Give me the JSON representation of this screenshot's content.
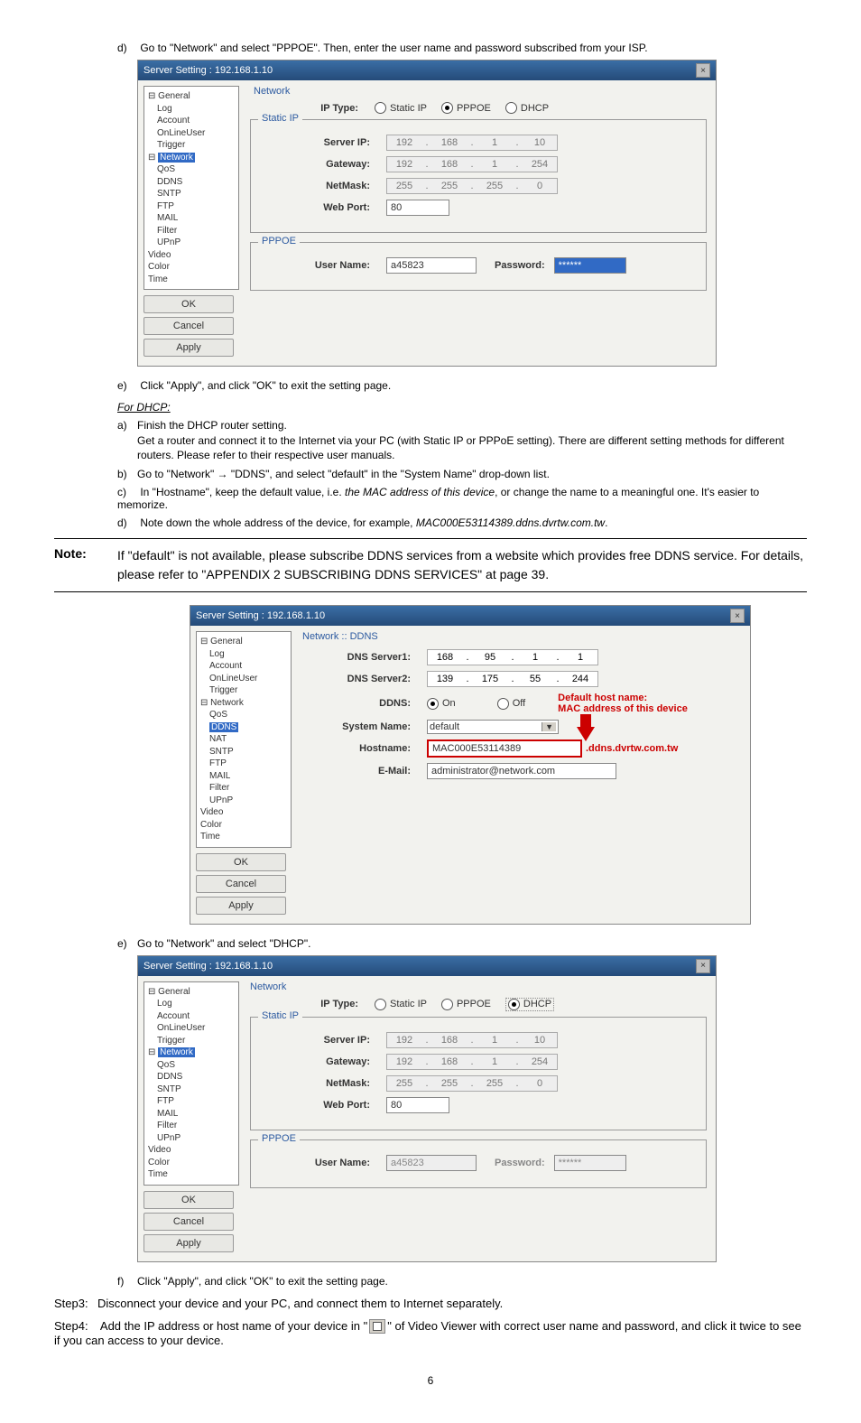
{
  "steps_pppoe": {
    "d": "Go to \"Network\" and select \"PPPOE\". Then, enter the user name and password subscribed from your ISP.",
    "e": "Click \"Apply\", and click \"OK\" to exit the setting page."
  },
  "dhcp_heading": "For DHCP:",
  "dhcp_steps": {
    "a1": "Finish the DHCP router setting.",
    "a2": "Get a router and connect it to the Internet via your PC (with Static IP or PPPoE setting). There are different setting methods for different routers. Please refer to their respective user manuals.",
    "b": "Go to \"Network\" → \"DDNS\", and select \"default\" in the \"System Name\" drop-down list.",
    "c1": "In \"Hostname\", keep the default value, i.e. ",
    "c1_italic": "the MAC address of this device",
    "c1_tail": ", or change the name to a meaningful one. It's easier to memorize.",
    "d1": "Note down the whole address of the device, for example, ",
    "d1_italic": "MAC000E53114389.ddns.dvrtw.com.tw",
    "d1_tail": "."
  },
  "note": {
    "label": "Note:",
    "text": "If \"default\" is not available, please subscribe DDNS services from a website which provides free DDNS service. For details, please refer to \"APPENDIX 2 SUBSCRIBING DDNS SERVICES\" at page 39."
  },
  "dhcp_e": "Go to \"Network\" and select \"DHCP\".",
  "dhcp_f": "Click \"Apply\", and click \"OK\" to exit the setting page.",
  "step3": "Disconnect your device and your PC, and connect them to Internet separately.",
  "step4a": "Add the IP address or host name of your device in \"",
  "step4b": "\" of Video Viewer with correct user name and password, and click it twice to see if you can access to your device.",
  "page_number": "6",
  "window": {
    "title": "Server Setting : 192.168.1.10",
    "buttons": {
      "ok": "OK",
      "cancel": "Cancel",
      "apply": "Apply"
    },
    "tree": {
      "general": "General",
      "log": "Log",
      "account": "Account",
      "online": "OnLineUser",
      "trigger": "Trigger",
      "network": "Network",
      "qos": "QoS",
      "ddns": "DDNS",
      "nat": "NAT",
      "sntp": "SNTP",
      "ftp": "FTP",
      "mail": "MAIL",
      "filter": "Filter",
      "upnp": "UPnP",
      "video": "Video",
      "color": "Color",
      "time": "Time"
    },
    "network_label": "Network",
    "ddns_label": "Network :: DDNS",
    "labels": {
      "iptype": "IP Type:",
      "staticip_group": "Static IP",
      "serverip": "Server IP:",
      "gateway": "Gateway:",
      "netmask": "NetMask:",
      "webport": "Web Port:",
      "pppoe_group": "PPPOE",
      "username": "User Name:",
      "password": "Password:",
      "dns1": "DNS Server1:",
      "dns2": "DNS Server2:",
      "ddns": "DDNS:",
      "sysname": "System Name:",
      "hostname": "Hostname:",
      "email": "E-Mail:",
      "defhost": "Default host name:",
      "macaddr": "MAC address of this device"
    },
    "radios": {
      "static": "Static IP",
      "pppoe": "PPPOE",
      "dhcp": "DHCP",
      "on": "On",
      "off": "Off"
    },
    "values": {
      "ip": [
        "192",
        "168",
        "1",
        "10"
      ],
      "gw": [
        "192",
        "168",
        "1",
        "254"
      ],
      "mask": [
        "255",
        "255",
        "255",
        "0"
      ],
      "port": "80",
      "user": "a45823",
      "pass": "******",
      "dns1": [
        "168",
        "95",
        "1",
        "1"
      ],
      "dns2": [
        "139",
        "175",
        "55",
        "244"
      ],
      "sysname": "default",
      "hostname": "MAC000E53114389",
      "hostsuffix": ".ddns.dvrtw.com.tw",
      "email": "administrator@network.com"
    }
  }
}
